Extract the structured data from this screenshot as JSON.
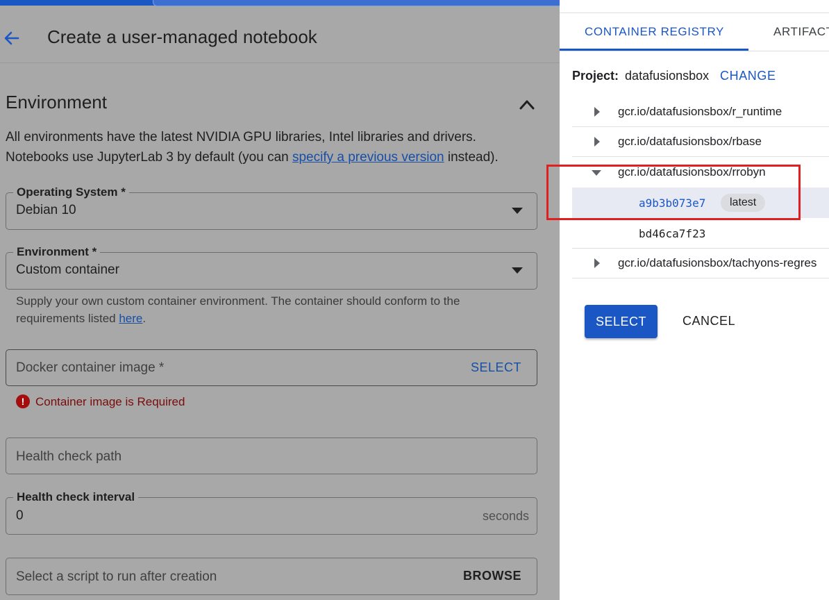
{
  "header": {
    "title": "Create a user-managed notebook"
  },
  "section": {
    "title": "Environment",
    "desc_line1": "All environments have the latest NVIDIA GPU libraries, Intel libraries and drivers.",
    "desc_line2_prefix": "Notebooks use JupyterLab 3 by default (you can ",
    "desc_line2_link": "specify a previous version",
    "desc_line2_suffix": " instead)."
  },
  "form": {
    "os": {
      "label": "Operating System *",
      "value": "Debian 10"
    },
    "environment": {
      "label": "Environment *",
      "value": "Custom container",
      "hint_line1": "Supply your own custom container environment. The container should conform to the",
      "hint_line2_prefix": "requirements listed ",
      "hint_link": "here",
      "hint_line2_suffix": "."
    },
    "docker_image": {
      "placeholder": "Docker container image *",
      "select_label": "SELECT",
      "error": "Container image is Required"
    },
    "health_check_path": {
      "placeholder": "Health check path"
    },
    "health_check_interval": {
      "label": "Health check interval",
      "value": "0",
      "suffix": "seconds"
    },
    "post_script": {
      "placeholder": "Select a script to run after creation",
      "browse_label": "BROWSE"
    }
  },
  "panel": {
    "tabs": [
      "CONTAINER REGISTRY",
      "ARTIFACT"
    ],
    "project_label": "Project:",
    "project_value": "datafusionsbox",
    "change_label": "CHANGE",
    "repos": [
      "gcr.io/datafusionsbox/r_runtime",
      "gcr.io/datafusionsbox/rbase",
      "gcr.io/datafusionsbox/rrobyn",
      "gcr.io/datafusionsbox/tachyons-regres"
    ],
    "tags": [
      {
        "digest": "a9b3b073e7",
        "chip": "latest"
      },
      {
        "digest": "bd46ca7f23"
      }
    ],
    "select_label": "SELECT",
    "cancel_label": "CANCEL"
  },
  "colors": {
    "accent": "#1a56c4",
    "error": "#a50e0e",
    "highlight": "#e02020",
    "overlay_gray": "#a8a8a8"
  },
  "icons": {
    "back": "arrow-left-icon",
    "collapse": "chevron-up-icon",
    "dropdown": "caret-down-icon",
    "error": "exclamation-circle-icon",
    "tree_collapsed": "triangle-right-icon",
    "tree_expanded": "triangle-down-icon"
  }
}
